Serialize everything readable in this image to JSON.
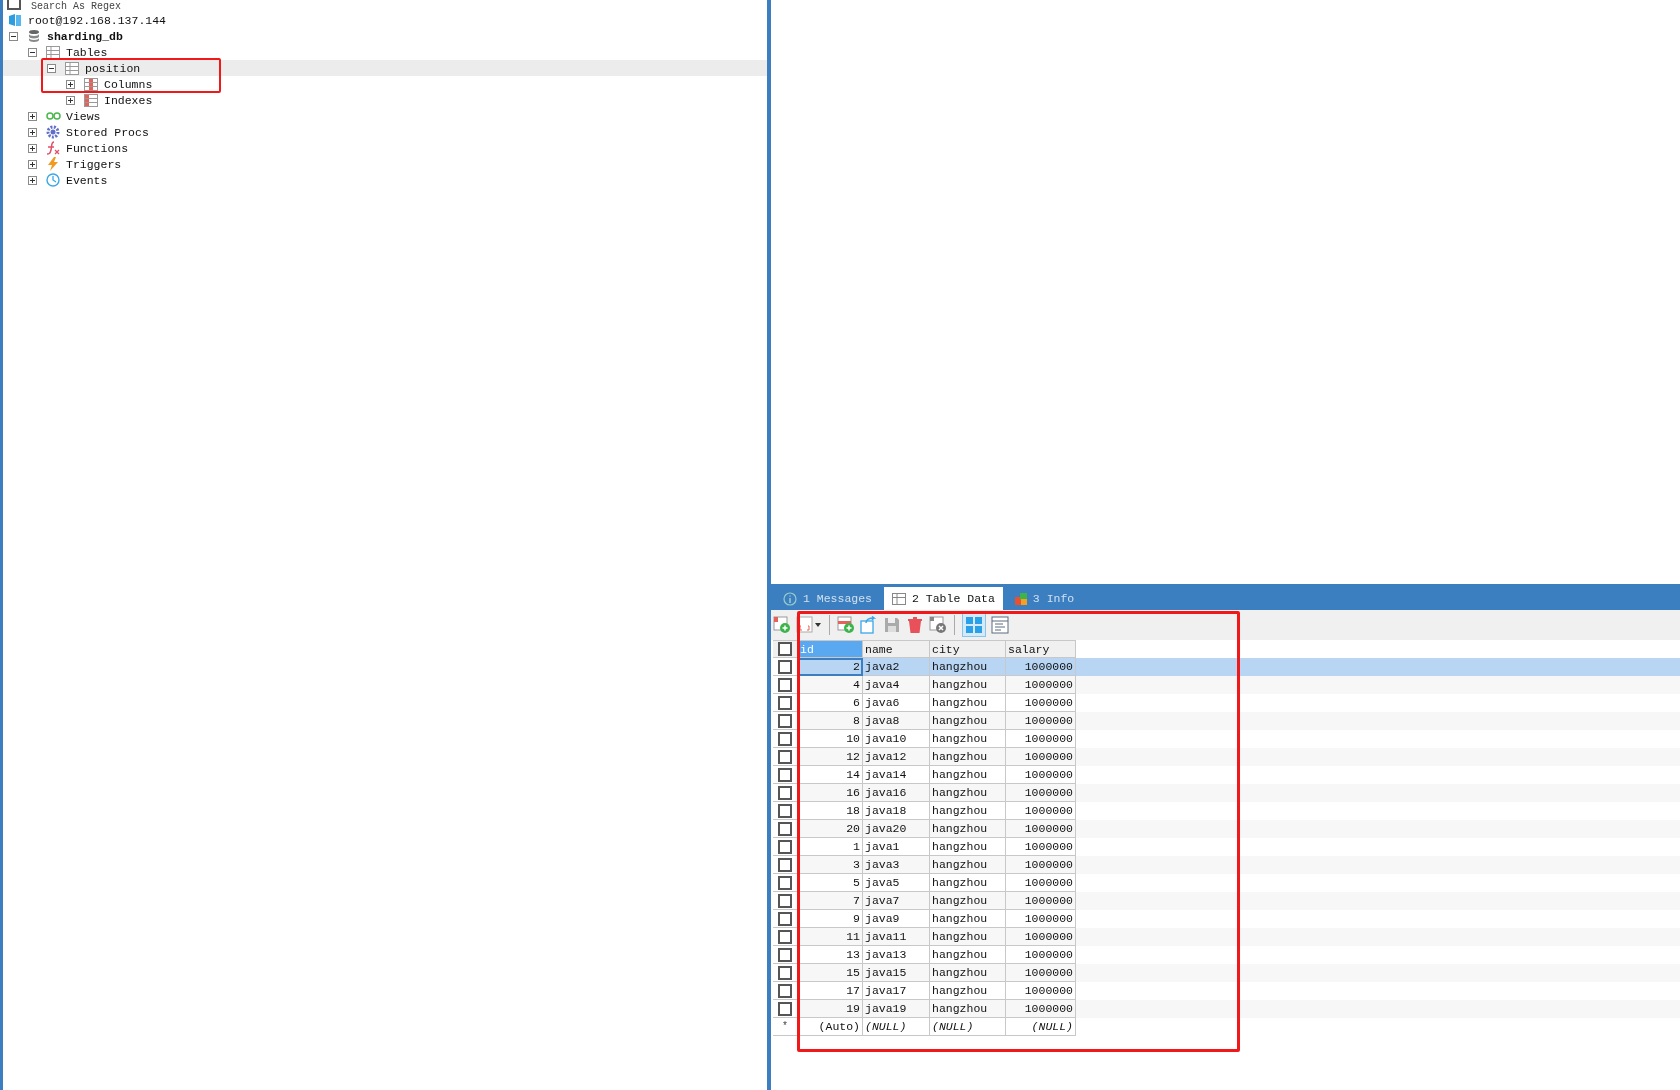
{
  "filter": {
    "label": "Search As Regex",
    "checked": false
  },
  "tree": [
    {
      "label": "root@192.168.137.144",
      "kind": "connection",
      "bold": false,
      "selected": false,
      "children": [
        {
          "label": "sharding_db",
          "kind": "database",
          "bold": true,
          "expanded": true,
          "selected": false,
          "children": [
            {
              "label": "Tables",
              "kind": "tables",
              "bold": false,
              "expanded": true,
              "selected": false,
              "children": [
                {
                  "label": "position",
                  "kind": "table",
                  "bold": false,
                  "expanded": true,
                  "selected": true,
                  "children": [
                    {
                      "label": "Columns",
                      "kind": "columns",
                      "bold": false,
                      "expanded": false,
                      "selected": false
                    },
                    {
                      "label": "Indexes",
                      "kind": "indexes",
                      "bold": false,
                      "expanded": false,
                      "selected": false
                    }
                  ]
                }
              ]
            },
            {
              "label": "Views",
              "kind": "views",
              "bold": false,
              "expanded": false,
              "selected": false
            },
            {
              "label": "Stored Procs",
              "kind": "procs",
              "bold": false,
              "expanded": false,
              "selected": false
            },
            {
              "label": "Functions",
              "kind": "functions",
              "bold": false,
              "expanded": false,
              "selected": false
            },
            {
              "label": "Triggers",
              "kind": "triggers",
              "bold": false,
              "expanded": false,
              "selected": false
            },
            {
              "label": "Events",
              "kind": "events",
              "bold": false,
              "expanded": false,
              "selected": false
            }
          ]
        }
      ]
    }
  ],
  "result_tabs": [
    {
      "label": "1 Messages",
      "kind": "info",
      "selected": false
    },
    {
      "label": "2 Table Data",
      "kind": "table",
      "selected": true
    },
    {
      "label": "3 Info",
      "kind": "blocks",
      "selected": false
    }
  ],
  "table": {
    "select_all": {
      "checked": false
    },
    "columns": [
      "id",
      "name",
      "city",
      "salary"
    ],
    "rows": [
      {
        "cells": [
          "2",
          "java2",
          "hangzhou",
          "1000000"
        ],
        "selected": true,
        "checked": false
      },
      {
        "cells": [
          "4",
          "java4",
          "hangzhou",
          "1000000"
        ],
        "selected": false,
        "checked": false
      },
      {
        "cells": [
          "6",
          "java6",
          "hangzhou",
          "1000000"
        ],
        "selected": false,
        "checked": false
      },
      {
        "cells": [
          "8",
          "java8",
          "hangzhou",
          "1000000"
        ],
        "selected": false,
        "checked": false
      },
      {
        "cells": [
          "10",
          "java10",
          "hangzhou",
          "1000000"
        ],
        "selected": false,
        "checked": false
      },
      {
        "cells": [
          "12",
          "java12",
          "hangzhou",
          "1000000"
        ],
        "selected": false,
        "checked": false
      },
      {
        "cells": [
          "14",
          "java14",
          "hangzhou",
          "1000000"
        ],
        "selected": false,
        "checked": false
      },
      {
        "cells": [
          "16",
          "java16",
          "hangzhou",
          "1000000"
        ],
        "selected": false,
        "checked": false
      },
      {
        "cells": [
          "18",
          "java18",
          "hangzhou",
          "1000000"
        ],
        "selected": false,
        "checked": false
      },
      {
        "cells": [
          "20",
          "java20",
          "hangzhou",
          "1000000"
        ],
        "selected": false,
        "checked": false
      },
      {
        "cells": [
          "1",
          "java1",
          "hangzhou",
          "1000000"
        ],
        "selected": false,
        "checked": false
      },
      {
        "cells": [
          "3",
          "java3",
          "hangzhou",
          "1000000"
        ],
        "selected": false,
        "checked": false
      },
      {
        "cells": [
          "5",
          "java5",
          "hangzhou",
          "1000000"
        ],
        "selected": false,
        "checked": false
      },
      {
        "cells": [
          "7",
          "java7",
          "hangzhou",
          "1000000"
        ],
        "selected": false,
        "checked": false
      },
      {
        "cells": [
          "9",
          "java9",
          "hangzhou",
          "1000000"
        ],
        "selected": false,
        "checked": false
      },
      {
        "cells": [
          "11",
          "java11",
          "hangzhou",
          "1000000"
        ],
        "selected": false,
        "checked": false
      },
      {
        "cells": [
          "13",
          "java13",
          "hangzhou",
          "1000000"
        ],
        "selected": false,
        "checked": false
      },
      {
        "cells": [
          "15",
          "java15",
          "hangzhou",
          "1000000"
        ],
        "selected": false,
        "checked": false
      },
      {
        "cells": [
          "17",
          "java17",
          "hangzhou",
          "1000000"
        ],
        "selected": false,
        "checked": false
      },
      {
        "cells": [
          "19",
          "java19",
          "hangzhou",
          "1000000"
        ],
        "selected": false,
        "checked": false
      }
    ],
    "new_row": {
      "marker": "*",
      "cells": [
        "(Auto)",
        "(NULL)",
        "(NULL)",
        "(NULL)"
      ]
    }
  }
}
